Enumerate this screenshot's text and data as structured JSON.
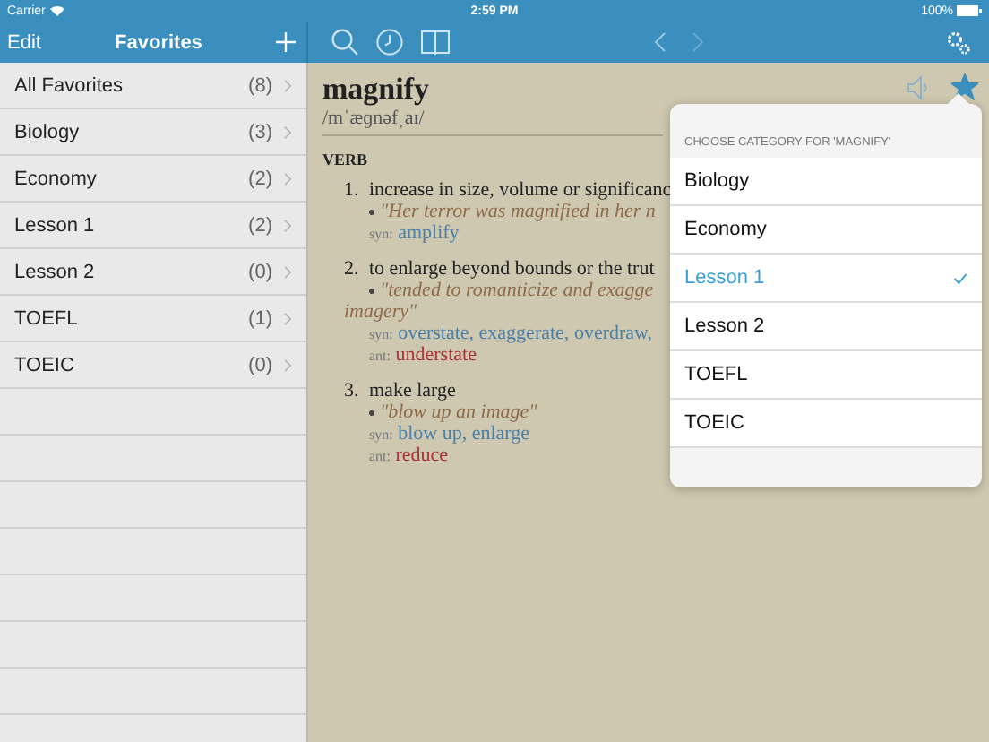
{
  "status_bar": {
    "carrier": "Carrier",
    "time": "2:59 PM",
    "battery": "100%"
  },
  "sidebar": {
    "edit": "Edit",
    "title": "Favorites",
    "items": [
      {
        "label": "All Favorites",
        "count": "(8)"
      },
      {
        "label": "Biology",
        "count": "(3)"
      },
      {
        "label": "Economy",
        "count": "(2)"
      },
      {
        "label": "Lesson 1",
        "count": "(2)"
      },
      {
        "label": "Lesson 2",
        "count": "(0)"
      },
      {
        "label": "TOEFL",
        "count": "(1)"
      },
      {
        "label": "TOEIC",
        "count": "(0)"
      }
    ]
  },
  "entry": {
    "word": "magnify",
    "pronunciation": "/mˈæɡnəfˌaɪ/",
    "favorite": true,
    "part_of_speech": "VERB",
    "senses": [
      {
        "number": "1.",
        "definition": "increase in size, volume or significanc",
        "example_lines": [
          "\"Her terror was magnified in her n"
        ],
        "syn_label": "syn:",
        "syn": [
          "amplify"
        ]
      },
      {
        "number": "2.",
        "definition": "to enlarge beyond bounds or the trut",
        "example_lines": [
          "\"tended to romanticize and exagge",
          "imagery\""
        ],
        "syn_label": "syn:",
        "syn": [
          "overstate,",
          "exaggerate,",
          "overdraw,"
        ],
        "ant_label": "ant:",
        "ant": [
          "understate"
        ]
      },
      {
        "number": "3.",
        "definition": "make large",
        "example_lines": [
          "\"blow up an image\""
        ],
        "syn_label": "syn:",
        "syn": [
          "blow up,",
          "enlarge"
        ],
        "ant_label": "ant:",
        "ant": [
          "reduce"
        ]
      }
    ]
  },
  "popover": {
    "header": "CHOOSE CATEGORY FOR 'MAGNIFY'",
    "items": [
      {
        "label": "Biology",
        "selected": false
      },
      {
        "label": "Economy",
        "selected": false
      },
      {
        "label": "Lesson 1",
        "selected": true
      },
      {
        "label": "Lesson 2",
        "selected": false
      },
      {
        "label": "TOEFL",
        "selected": false
      },
      {
        "label": "TOEIC",
        "selected": false
      }
    ]
  }
}
